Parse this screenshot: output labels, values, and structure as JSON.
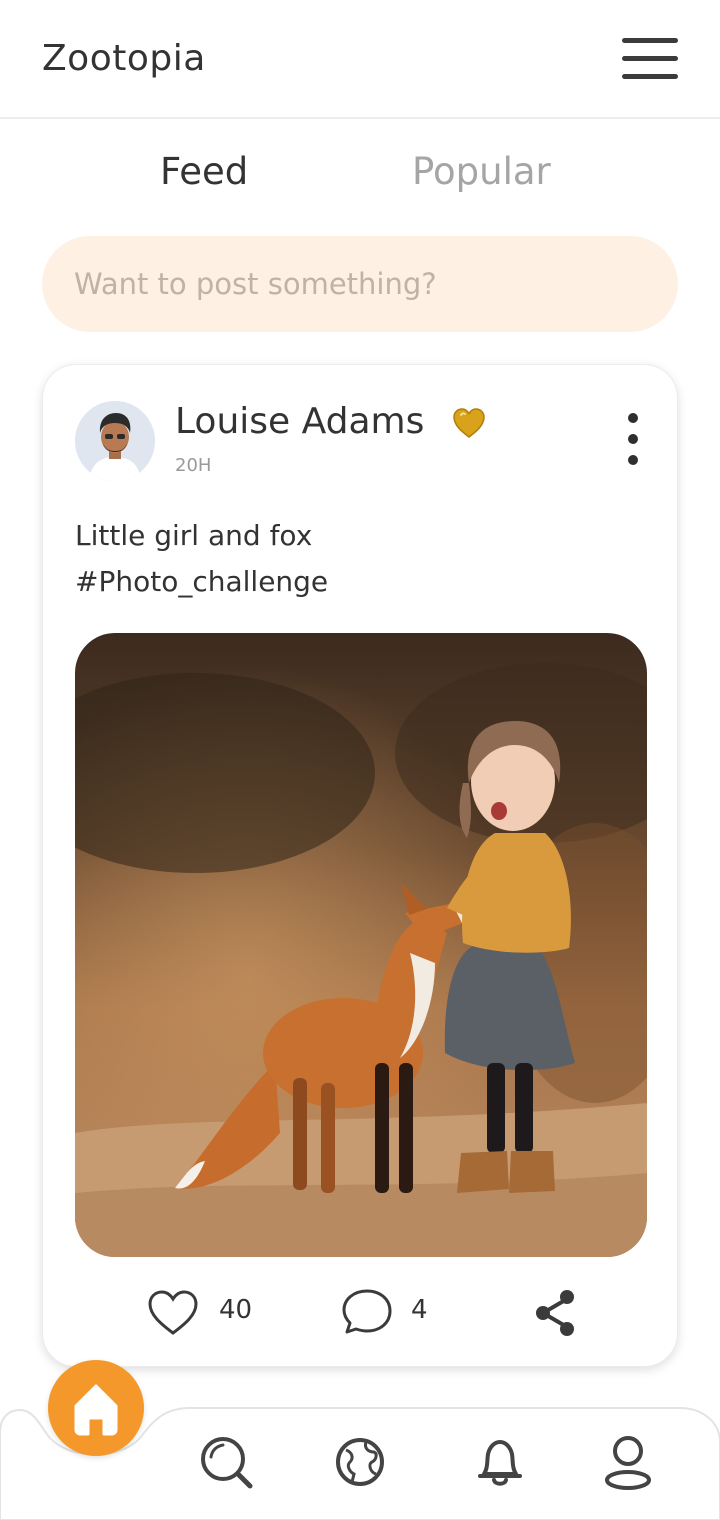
{
  "app": {
    "title": "Zootopia"
  },
  "tabs": [
    {
      "label": "Feed",
      "active": true
    },
    {
      "label": "Popular",
      "active": false
    }
  ],
  "composer": {
    "placeholder": "Want to post something?"
  },
  "post": {
    "author": "Louise Adams",
    "time": "20H",
    "text_line1": "Little girl and fox",
    "text_line2": "#Photo_challenge",
    "likes": "40",
    "comments": "4",
    "image_icon": "photo-girl-and-fox"
  },
  "icons": {
    "menu": "hamburger-menu-icon",
    "badge": "gold-heart-icon",
    "more": "vertical-dots-icon",
    "like": "heart-outline-icon",
    "comment": "chat-bubble-icon",
    "share": "share-icon",
    "home": "home-icon",
    "search": "search-icon",
    "explore": "globe-icon",
    "notifications": "bell-icon",
    "profile": "user-icon"
  },
  "colors": {
    "accent": "#f5982b",
    "composer_bg": "#fff0e4",
    "active_tab": "#333333",
    "inactive_tab": "#a5a5a5",
    "icon": "#3b3b3b"
  }
}
